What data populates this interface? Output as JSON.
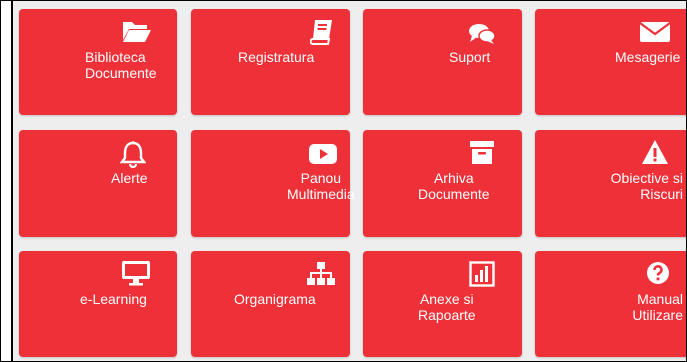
{
  "tiles": [
    {
      "label": "Biblioteca\nDocumente",
      "icon": "folder-open-icon"
    },
    {
      "label": "Registratura",
      "icon": "book-icon"
    },
    {
      "label": "Suport",
      "icon": "comments-icon"
    },
    {
      "label": "Mesagerie",
      "icon": "envelope-icon"
    },
    {
      "label": "Alerte",
      "icon": "bell-icon"
    },
    {
      "label": "Panou\nMultimedia",
      "icon": "youtube-play-icon"
    },
    {
      "label": "Arhiva\nDocumente",
      "icon": "archive-box-icon"
    },
    {
      "label": "Obiective si\nRiscuri",
      "icon": "warning-triangle-icon"
    },
    {
      "label": "e-Learning",
      "icon": "desktop-monitor-icon"
    },
    {
      "label": "Organigrama",
      "icon": "sitemap-icon"
    },
    {
      "label": "Anexe si\nRapoarte",
      "icon": "bar-chart-icon"
    },
    {
      "label": "Manual\nUtilizare",
      "icon": "question-circle-icon"
    }
  ],
  "colors": {
    "tile": "#ee3038",
    "background": "#eeeeee",
    "text": "#ffffff"
  }
}
